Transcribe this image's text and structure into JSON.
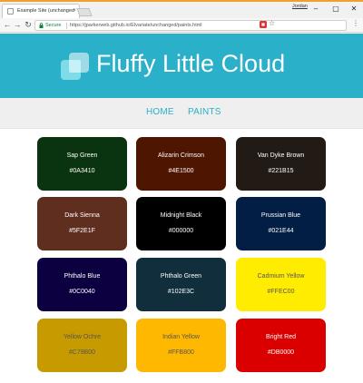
{
  "browser": {
    "tab_title": "Example Site (unchanged",
    "user_label": "Jordan",
    "secure_label": "Secure",
    "url": "https://jparkerweb.github.io/Elvariate/unchanged/paints.html",
    "window_controls": [
      "minimize-icon",
      "maximize-icon",
      "close-icon"
    ]
  },
  "site": {
    "title": "Fluffy Little Cloud",
    "logo_icon": "cloud-squares-icon",
    "header_color": "#2AB0C8"
  },
  "nav": {
    "home": "HOME",
    "paints": "PAINTS"
  },
  "paints": [
    {
      "name": "Sap Green",
      "code": "#0A3410",
      "bg": "#0A3410",
      "fg": "#ffffff"
    },
    {
      "name": "Alizarin Crimson",
      "code": "#4E1500",
      "bg": "#4E1500",
      "fg": "#ffffff"
    },
    {
      "name": "Van Dyke Brown",
      "code": "#221B15",
      "bg": "#221B15",
      "fg": "#ffffff"
    },
    {
      "name": "Dark Sienna",
      "code": "#5F2E1F",
      "bg": "#5F2E1F",
      "fg": "#ffffff"
    },
    {
      "name": "Midnight Black",
      "code": "#000000",
      "bg": "#000000",
      "fg": "#ffffff"
    },
    {
      "name": "Prussian Blue",
      "code": "#021E44",
      "bg": "#021E44",
      "fg": "#ffffff"
    },
    {
      "name": "Phthalo Blue",
      "code": "#0C0040",
      "bg": "#0C0040",
      "fg": "#ffffff"
    },
    {
      "name": "Phthalo Green",
      "code": "#102E3C",
      "bg": "#102E3C",
      "fg": "#ffffff"
    },
    {
      "name": "Cadmium Yellow",
      "code": "#FFEC00",
      "bg": "#FFEC00",
      "fg": "#555555"
    },
    {
      "name": "Yellow Ochre",
      "code": "#C79B00",
      "bg": "#C79B00",
      "fg": "#555555"
    },
    {
      "name": "Indian Yellow",
      "code": "#FFB800",
      "bg": "#FFB800",
      "fg": "#555555"
    },
    {
      "name": "Bright Red",
      "code": "#DB0000",
      "bg": "#DB0000",
      "fg": "#ffffff"
    }
  ]
}
